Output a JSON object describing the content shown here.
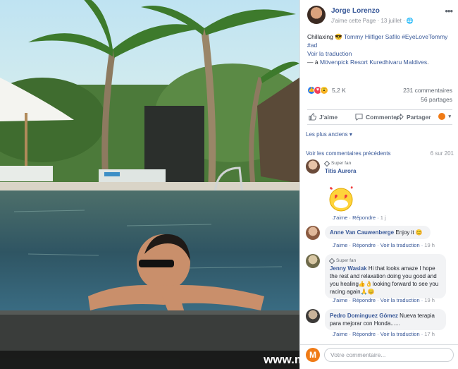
{
  "post": {
    "author": "Jorge Lorenzo",
    "meta": "J'aime cette Page · 13 juillet · 🌐",
    "more": "•••",
    "text_plain": "Chillaxing 😎 ",
    "text_tags": "Tommy Hilfiger Safilo #EyeLoveTommy #ad",
    "translate": "Voir la traduction",
    "location_prefix": "— à ",
    "location": "Mövenpick Resort Kuredhivaru Maldives",
    "location_suffix": "."
  },
  "stats": {
    "reactions": "5,2 K",
    "comments": "231 commentaires",
    "shares": "56 partages"
  },
  "actions": {
    "like": "J'aime",
    "comment": "Commenter",
    "share": "Partager"
  },
  "sort_label": "Les plus anciens ▾",
  "prev_comments": "Voir les commentaires précédents",
  "comment_count": "6 sur 201",
  "link_like": "J'aime",
  "link_reply": "Répondre",
  "link_translate": "Voir la traduction",
  "comments": [
    {
      "badge": "Super fan",
      "name": "Titis Aurora",
      "text": "",
      "time": "1 j"
    },
    {
      "badge": "",
      "name": "Anne Van Cauwenberge",
      "text": "Enjoy it 😊",
      "time": "19 h"
    },
    {
      "badge": "Super fan",
      "name": "Jenny Wasiak",
      "text": "Hi that looks amaze I hope the rest and relaxation doing you good and you healing👍👌looking forward to see you racing again🙏😊",
      "time": "19 h"
    },
    {
      "badge": "",
      "name": "Pedro Dominguez Gómez",
      "text": "Nueva terapia para mejorar con Honda......",
      "time": "17 h"
    }
  ],
  "composer_placeholder": "Votre commentaire...",
  "watermark": "www.moto-net.com - Photo © DR",
  "colors": {
    "link": "#385898",
    "bubble": "#f2f3f5",
    "muted": "#90949c"
  }
}
